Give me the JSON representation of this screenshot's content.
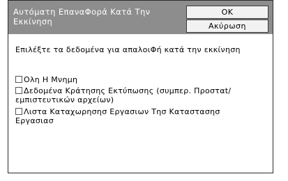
{
  "dialog": {
    "title": "Αυτόματη ΕπαναΦορά Κατά Την Εκκίνηση",
    "ok_label": "OK",
    "cancel_label": "Ακύρωση",
    "instruction": "Επιλέξτε τα δεδομένα για απαλοιΦή κατά την εκκίνηση",
    "options": [
      {
        "label": "Ολη Η Μνημη",
        "checked": false
      },
      {
        "label": "Δεδομένα Κράτησης Εκτύπωσης (συμπερ. Προσταt/ εμπιστευτικών αρχείων)",
        "checked": false
      },
      {
        "label": "Λιστα Καταχωρησησ Εργασιων Τησ Καταστασησ Εργασιασ",
        "checked": false
      }
    ]
  },
  "colors": {
    "titlebar": "#8d8d8d",
    "title_text": "#ffffff",
    "button_bg": "#f2f2f2",
    "border": "#2b2b2b"
  }
}
